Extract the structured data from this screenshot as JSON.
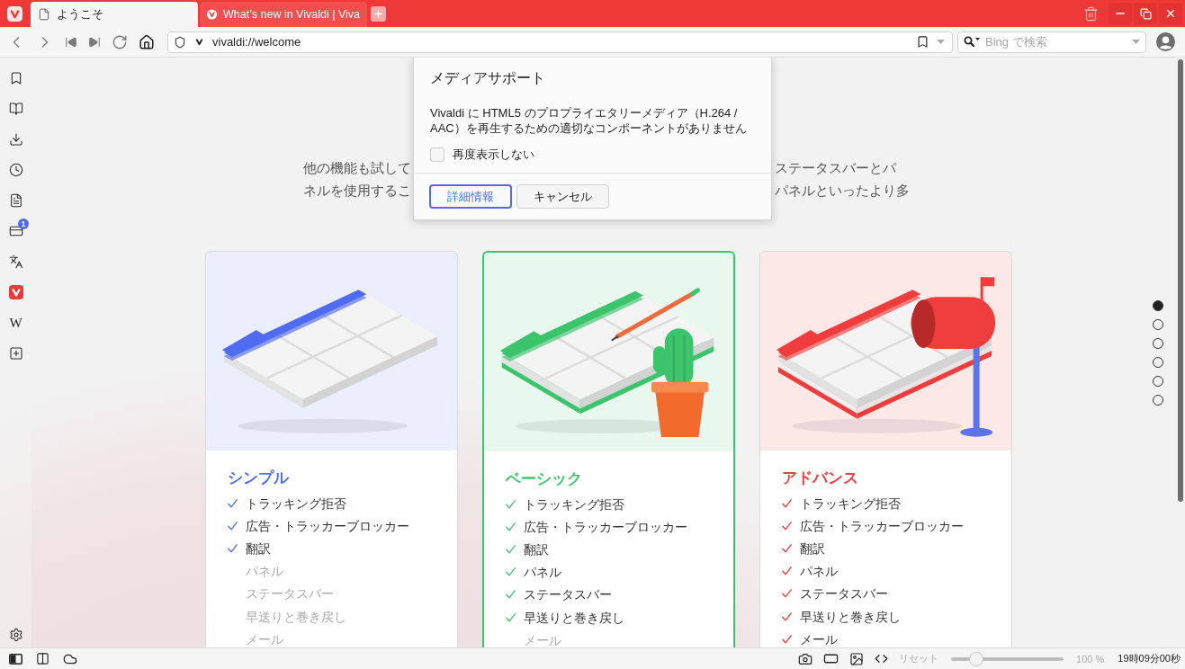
{
  "tabs": [
    {
      "title": "ようこそ",
      "selected": true,
      "kind": "document"
    },
    {
      "title": "What’s new in Vivaldi | Viva",
      "selected": false,
      "kind": "site"
    }
  ],
  "address_bar": {
    "url": "vivaldi://welcome"
  },
  "search_field": {
    "placeholder": "Bing で検索"
  },
  "side_panel": {
    "window_badge": "1",
    "web_panel_glyph": "W"
  },
  "dialog": {
    "title": "メディアサポート",
    "message": "Vivaldi に HTML5 のプロプライエタリーメディア（H.264 / AAC）を再生するための適切なコンポーネントがありません",
    "dont_show_again": {
      "label": "再度表示しない",
      "checked": false
    },
    "buttons": [
      {
        "label": "詳細情報",
        "kind": "primary"
      },
      {
        "label": "キャンセル",
        "kind": "secondary"
      }
    ]
  },
  "intro": {
    "lines": [
      {
        "left": "他の機能も試して",
        "right": "ステータスバーとパ"
      },
      {
        "left": "ネルを使用するこ",
        "right": "パネルといったより多"
      }
    ]
  },
  "cards": [
    {
      "title": "シンプル",
      "color": "#4f6cf0",
      "selected": false,
      "kind": "window",
      "features": [
        {
          "label": "トラッキング拒否",
          "included": true
        },
        {
          "label": "広告・トラッカーブロッカー",
          "included": true
        },
        {
          "label": "翻訳",
          "included": true
        },
        {
          "label": "パネル",
          "included": false
        },
        {
          "label": "ステータスバー",
          "included": false
        },
        {
          "label": "早送りと巻き戻し",
          "included": false
        },
        {
          "label": "メール",
          "included": false
        }
      ]
    },
    {
      "title": "ベーシック",
      "color": "#3cc46c",
      "selected": true,
      "kind": "window_cactus",
      "features": [
        {
          "label": "トラッキング拒否",
          "included": true
        },
        {
          "label": "広告・トラッカーブロッカー",
          "included": true
        },
        {
          "label": "翻訳",
          "included": true
        },
        {
          "label": "パネル",
          "included": true
        },
        {
          "label": "ステータスバー",
          "included": true
        },
        {
          "label": "早送りと巻き戻し",
          "included": true
        },
        {
          "label": "メール",
          "included": false
        }
      ]
    },
    {
      "title": "アドバンス",
      "color": "#ef3d3d",
      "selected": false,
      "kind": "window_mailbox",
      "features": [
        {
          "label": "トラッキング拒否",
          "included": true
        },
        {
          "label": "広告・トラッカーブロッカー",
          "included": true
        },
        {
          "label": "翻訳",
          "included": true
        },
        {
          "label": "パネル",
          "included": true
        },
        {
          "label": "ステータスバー",
          "included": true
        },
        {
          "label": "早送りと巻き戻し",
          "included": true
        },
        {
          "label": "メール",
          "included": true
        }
      ]
    }
  ],
  "page_dots": [
    {
      "selected": true
    },
    {
      "selected": false
    },
    {
      "selected": false
    },
    {
      "selected": false
    },
    {
      "selected": false
    },
    {
      "selected": false
    }
  ],
  "status_bar": {
    "reset": "リセット",
    "zoom": {
      "level": 0.18
    },
    "zoom_reading": "100 %",
    "clock": "19時09分00秒"
  }
}
